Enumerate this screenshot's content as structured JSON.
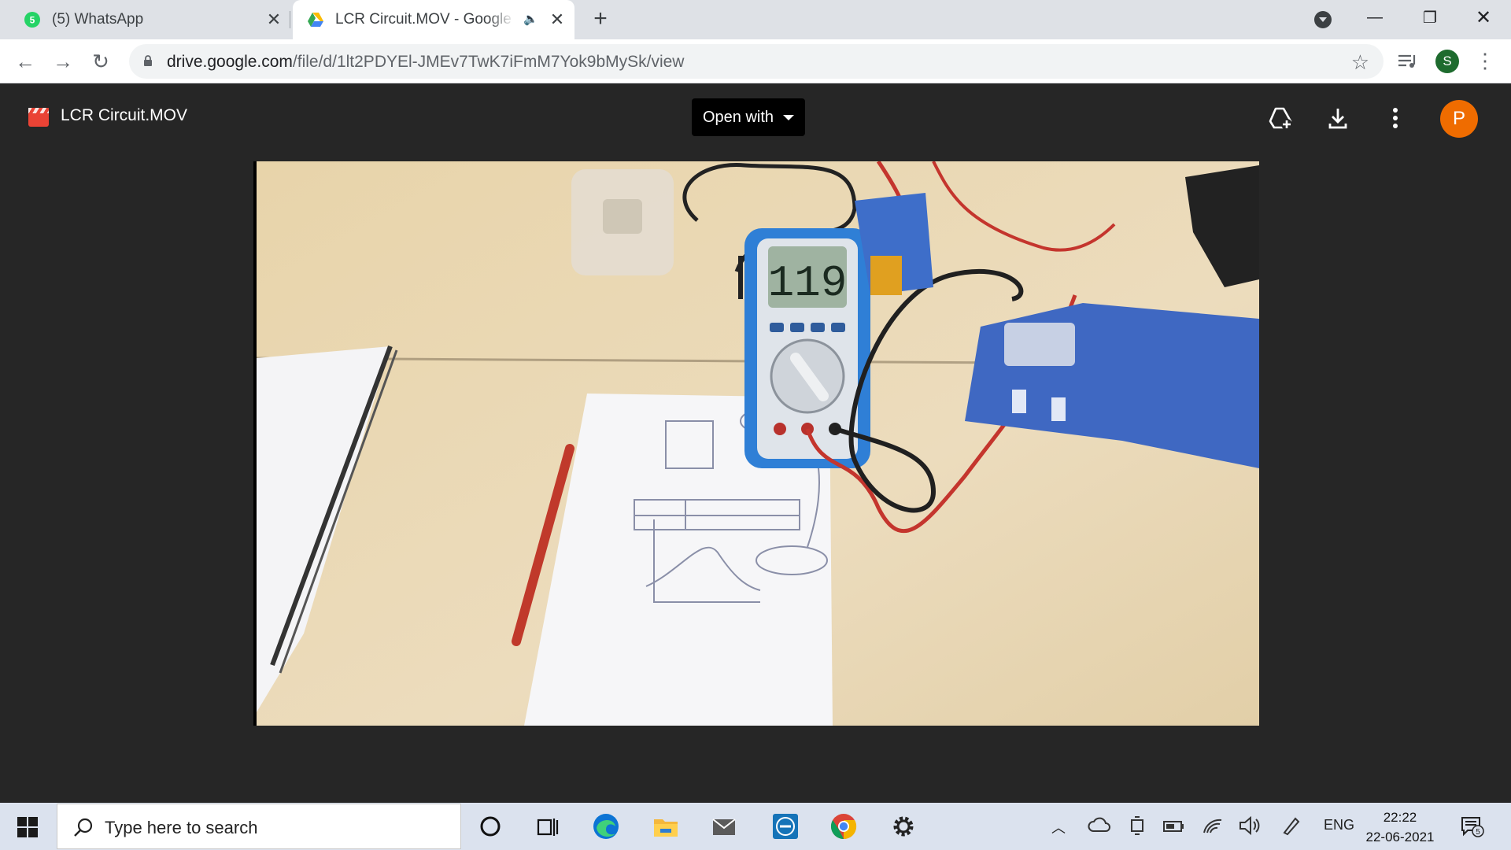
{
  "browser": {
    "tabs": [
      {
        "title": "(5) WhatsApp",
        "badge": "5",
        "icon": "whatsapp-icon",
        "active": false
      },
      {
        "title": "LCR Circuit.MOV - Google Drive",
        "icon": "google-drive-icon",
        "active": true,
        "audio": true
      }
    ],
    "address": {
      "host": "drive.google.com",
      "path": "/file/d/1lt2PDYEl-JMEv7TwK7iFmM7Yok9bMySk/view"
    },
    "profile_initial": "S"
  },
  "viewer": {
    "file_name": "LCR Circuit.MOV",
    "open_with_label": "Open with",
    "avatar_initial": "P",
    "multimeter_reading": "119"
  },
  "taskbar": {
    "search_placeholder": "Type here to search",
    "language": "ENG",
    "time": "22:22",
    "date": "22-06-2021",
    "notification_count": "5"
  },
  "colors": {
    "drive_bg": "#262626",
    "avatar": "#ef6c00",
    "tab_strip": "#dee1e6",
    "taskbar": "#dbe2ee"
  }
}
